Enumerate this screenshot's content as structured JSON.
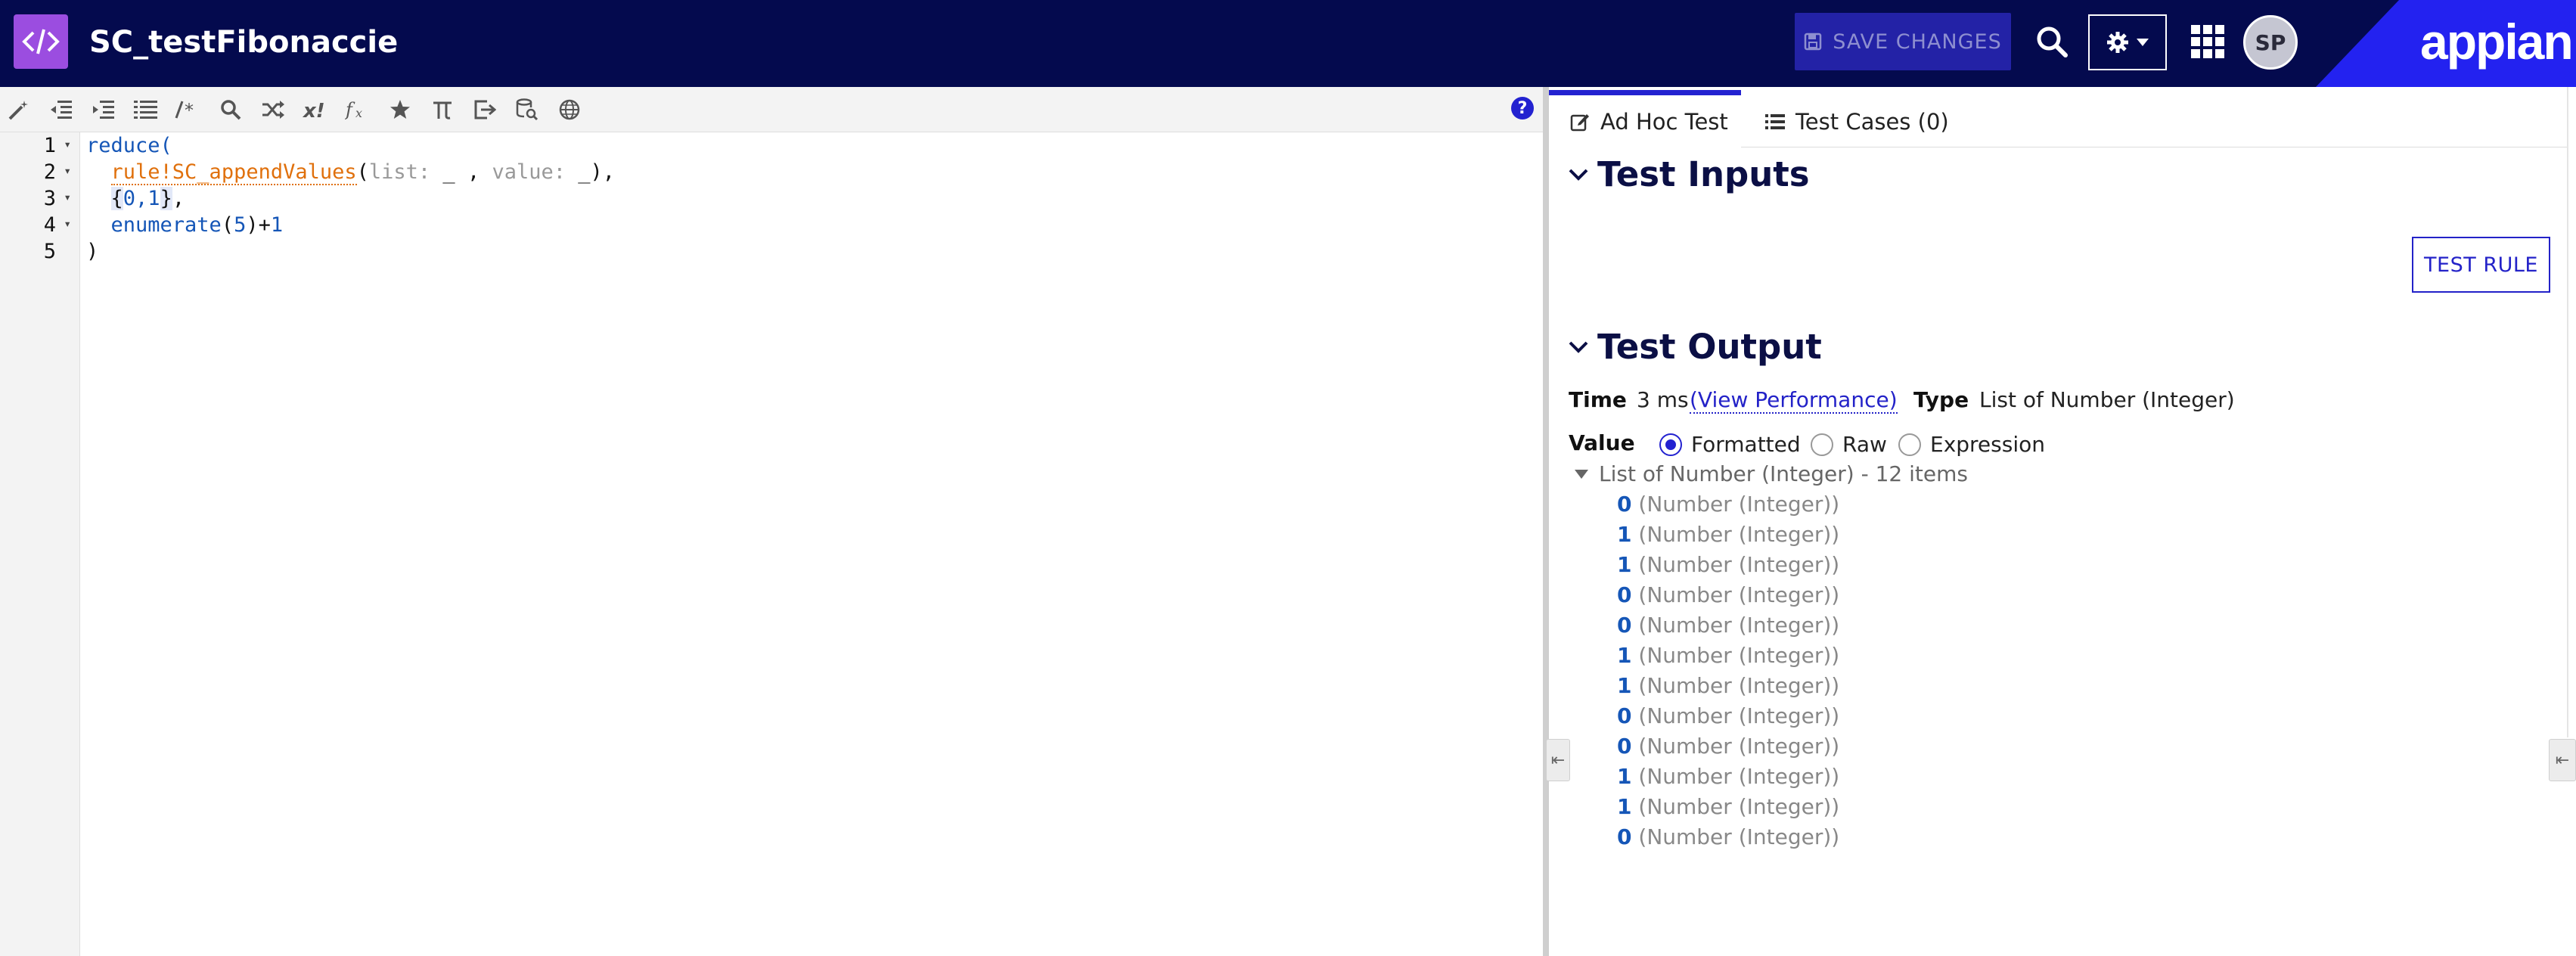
{
  "header": {
    "title": "SC_testFibonaccie",
    "save_label": "SAVE CHANGES",
    "avatar_initials": "SP",
    "brand": "appian",
    "colors": {
      "bar": "#040a4e",
      "accent": "#2322f0",
      "app_icon": "#9b4de0"
    }
  },
  "editor": {
    "toolbar_icons": [
      "magic-wand-icon",
      "outdent-icon",
      "indent-icon",
      "list-indent-icon",
      "comment-icon",
      "search-icon",
      "shuffle-icon",
      "x-factorial-icon",
      "fx-icon",
      "star-icon",
      "pi-icon",
      "export-icon",
      "database-search-icon",
      "globe-icon",
      "help-icon"
    ],
    "help_label": "?",
    "line_numbers": [
      "1",
      "2",
      "3",
      "4",
      "5"
    ],
    "lines": {
      "l1": "reduce(",
      "l2_rule": "rule!SC_appendValues",
      "l2_open": "(",
      "l2_list": "list:",
      "l2_mid1": " _ , ",
      "l2_value": "value:",
      "l2_mid2": " _),",
      "l3_open": "{",
      "l3_nums": "0,1",
      "l3_close": "}",
      "l3_comma": ",",
      "l4_fn": "enumerate",
      "l4_open": "(",
      "l4_num": "5",
      "l4_close": ")+",
      "l4_one": "1",
      "l5": ")"
    }
  },
  "right_panel": {
    "tabs": [
      {
        "label": "Ad Hoc Test",
        "active": true
      },
      {
        "label": "Test Cases (0)",
        "active": false
      }
    ],
    "test_inputs_title": "Test Inputs",
    "test_rule_label": "TEST RULE",
    "test_output_title": "Test Output",
    "time_label": "Time",
    "time_value": "3 ms",
    "view_performance": "(View Performance)",
    "type_label": "Type",
    "type_value": "List of Number (Integer)",
    "value_label": "Value",
    "radios": [
      "Formatted",
      "Raw",
      "Expression"
    ],
    "selected_radio": "Formatted",
    "list_header": "List of Number (Integer) - 12 items",
    "items": [
      {
        "value": "0",
        "type": "(Number (Integer))"
      },
      {
        "value": "1",
        "type": "(Number (Integer))"
      },
      {
        "value": "1",
        "type": "(Number (Integer))"
      },
      {
        "value": "0",
        "type": "(Number (Integer))"
      },
      {
        "value": "0",
        "type": "(Number (Integer))"
      },
      {
        "value": "1",
        "type": "(Number (Integer))"
      },
      {
        "value": "1",
        "type": "(Number (Integer))"
      },
      {
        "value": "0",
        "type": "(Number (Integer))"
      },
      {
        "value": "0",
        "type": "(Number (Integer))"
      },
      {
        "value": "1",
        "type": "(Number (Integer))"
      },
      {
        "value": "1",
        "type": "(Number (Integer))"
      },
      {
        "value": "0",
        "type": "(Number (Integer))"
      }
    ]
  }
}
